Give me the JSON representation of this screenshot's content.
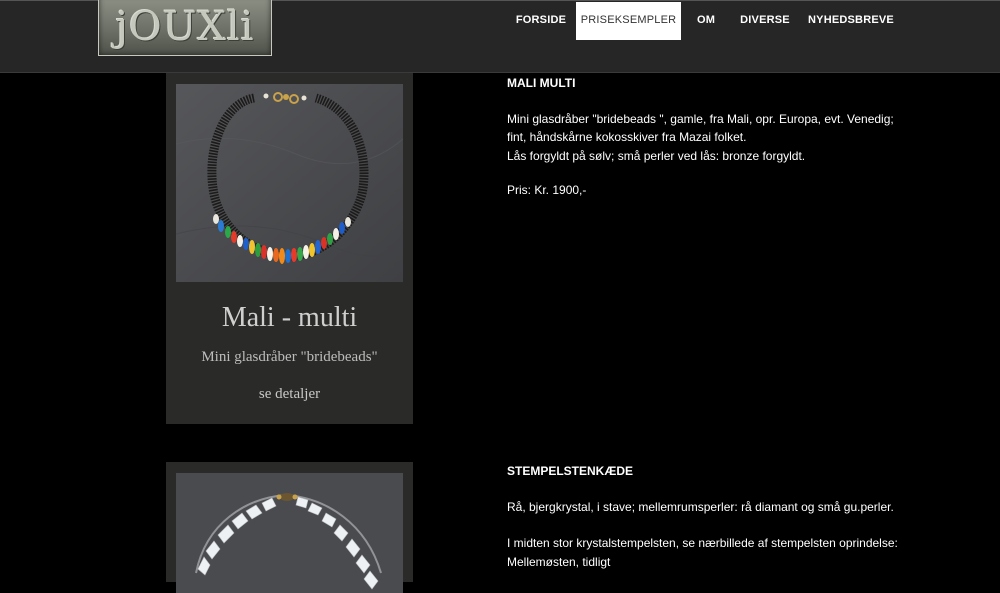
{
  "header": {
    "logo_text": "jOUXli",
    "nav": [
      {
        "label": "FORSIDE"
      },
      {
        "label": "PRISEKSEMPLER",
        "active": true
      },
      {
        "label": "OM"
      },
      {
        "label": "DIVERSE"
      },
      {
        "label": "NYHEDSBREVE"
      }
    ]
  },
  "products": [
    {
      "card_title": "Mali - multi",
      "card_subtitle": "Mini glasdråber \"bridebeads\"",
      "card_link": "se detaljer",
      "detail_title": "MALI MULTI",
      "detail_lines": [
        "Mini glasdråber \"bridebeads \", gamle, fra Mali, opr. Europa, evt. Venedig; fint, håndskårne kokosskiver fra Mazai folket.",
        "Lås forgyldt på sølv; små perler ved lås: bronze forgyldt."
      ],
      "price": "Pris: Kr. 1900,-"
    },
    {
      "detail_title": "STEMPELSTENKÆDE",
      "detail_lines": [
        "Rå, bjergkrystal, i stave; mellemrumsperler: rå diamant og små gu.perler.",
        "I midten stor krystalstempelsten, se nærbillede af stempelsten oprindelse: Mellemøsten, tidligt"
      ]
    }
  ]
}
